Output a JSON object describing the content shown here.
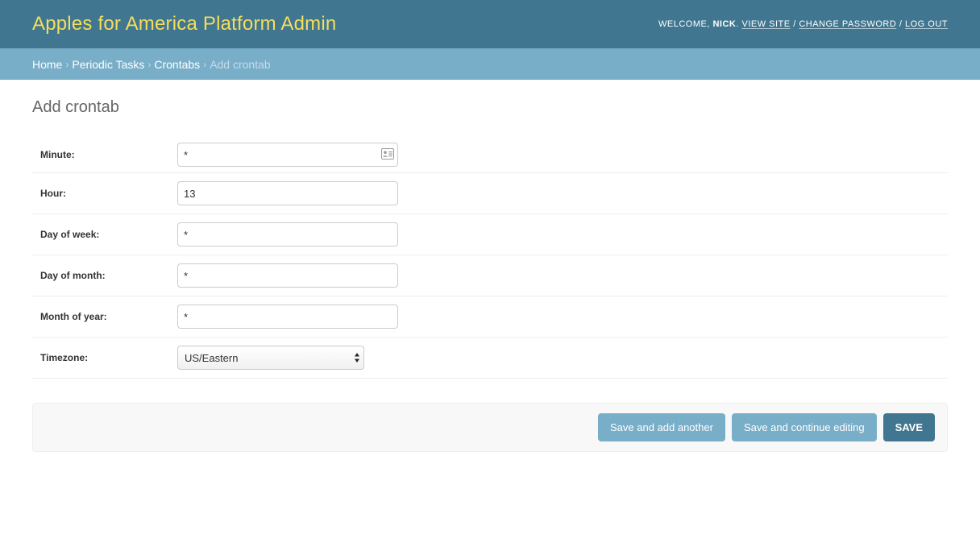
{
  "header": {
    "branding": "Apples for America Platform Admin",
    "welcome": "Welcome,",
    "username": "Nick",
    "view_site": "View site",
    "change_password": "Change password",
    "log_out": "Log out",
    "separator": "/"
  },
  "breadcrumbs": {
    "items": [
      "Home",
      "Periodic Tasks",
      "Crontabs"
    ],
    "current": "Add crontab",
    "separator": "›"
  },
  "page": {
    "title": "Add crontab"
  },
  "form": {
    "minute": {
      "label": "Minute:",
      "value": "*"
    },
    "hour": {
      "label": "Hour:",
      "value": "13"
    },
    "day_of_week": {
      "label": "Day of week:",
      "value": "*"
    },
    "day_of_month": {
      "label": "Day of month:",
      "value": "*"
    },
    "month_of_year": {
      "label": "Month of year:",
      "value": "*"
    },
    "timezone": {
      "label": "Timezone:",
      "selected": "US/Eastern"
    }
  },
  "submit": {
    "save_add_another": "Save and add another",
    "save_continue": "Save and continue editing",
    "save": "Save"
  },
  "icons": {
    "contact_card": "contact-card-icon",
    "select_arrows": "select-arrows-icon"
  },
  "colors": {
    "header_bg": "#417690",
    "branding": "#f5dd5d",
    "breadcrumbs_bg": "#79aec8",
    "primary_button": "#417690",
    "secondary_button": "#79aec8"
  }
}
